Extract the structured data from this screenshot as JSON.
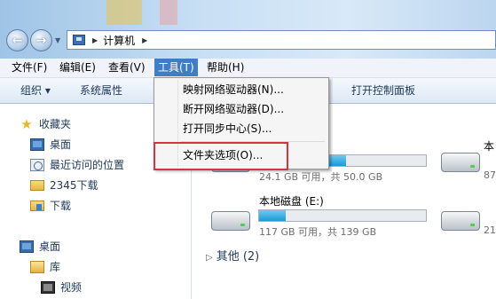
{
  "address": {
    "path": "计算机"
  },
  "menubar": [
    {
      "label": "文件(F)"
    },
    {
      "label": "编辑(E)"
    },
    {
      "label": "查看(V)"
    },
    {
      "label": "工具(T)"
    },
    {
      "label": "帮助(H)"
    }
  ],
  "toolbar": {
    "organize": "组织 ▾",
    "system_properties": "系统属性",
    "open_control_panel": "打开控制面板"
  },
  "sidebar": {
    "favorites": "收藏夹",
    "desktop": "桌面",
    "recent": "最近访问的位置",
    "downloads_2345": "2345下载",
    "downloads": "下载",
    "desktop2": "桌面",
    "library": "库",
    "videos": "视频"
  },
  "tools_menu": {
    "map_drive": "映射网络驱动器(N)...",
    "disconnect_drive": "断开网络驱动器(D)...",
    "open_sync_center": "打开同步中心(S)...",
    "folder_options": "文件夹选项(O)..."
  },
  "drives": [
    {
      "name": "",
      "space": "24.1 GB 可用，共 50.0 GB",
      "used_fraction": 0.52
    },
    {
      "name": "本地磁盘 (E:)",
      "space": "117 GB 可用，共 139 GB",
      "used_fraction": 0.16
    }
  ],
  "drives_right": [
    {
      "name": "本",
      "space": "87"
    },
    {
      "name": "",
      "space": "21"
    }
  ],
  "other_section": "其他 (2)",
  "colors": {
    "highlight": "#d8323f",
    "menu_active": "#3e7ec5"
  }
}
